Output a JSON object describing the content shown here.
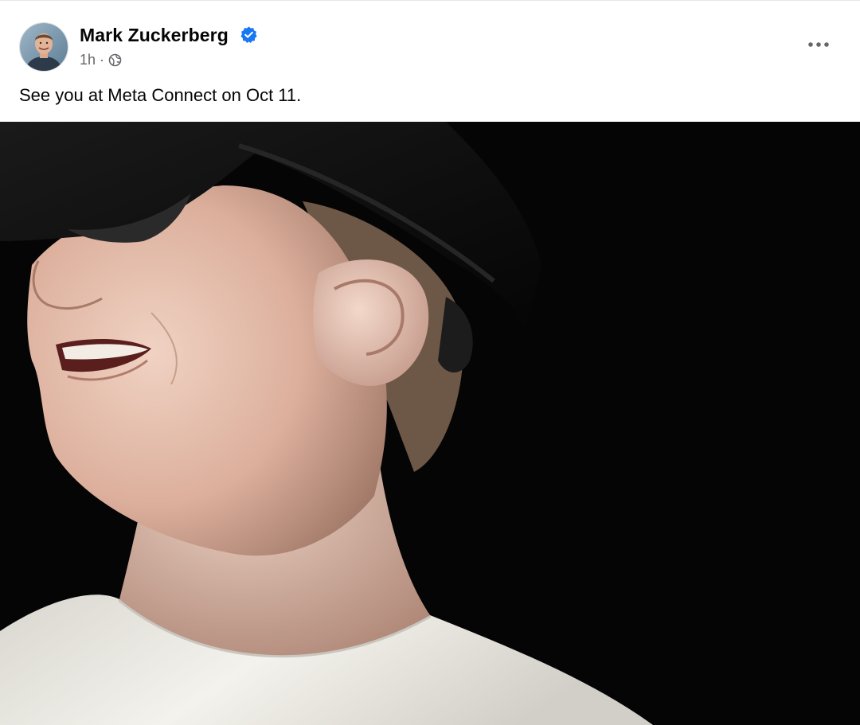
{
  "post": {
    "author": {
      "name": "Mark Zuckerberg",
      "verified": true,
      "verified_color": "#1877f2"
    },
    "meta": {
      "time": "1h",
      "separator": "·",
      "audience_icon": "globe-icon"
    },
    "menu_icon": "more-horizontal-icon",
    "text": "See you at Meta Connect on Oct 11.",
    "image": {
      "subject": "smiling man wearing a black VR headset, white sweater, black background"
    }
  },
  "colors": {
    "text_primary": "#050505",
    "text_secondary": "#65676b",
    "image_background": "#050505"
  }
}
